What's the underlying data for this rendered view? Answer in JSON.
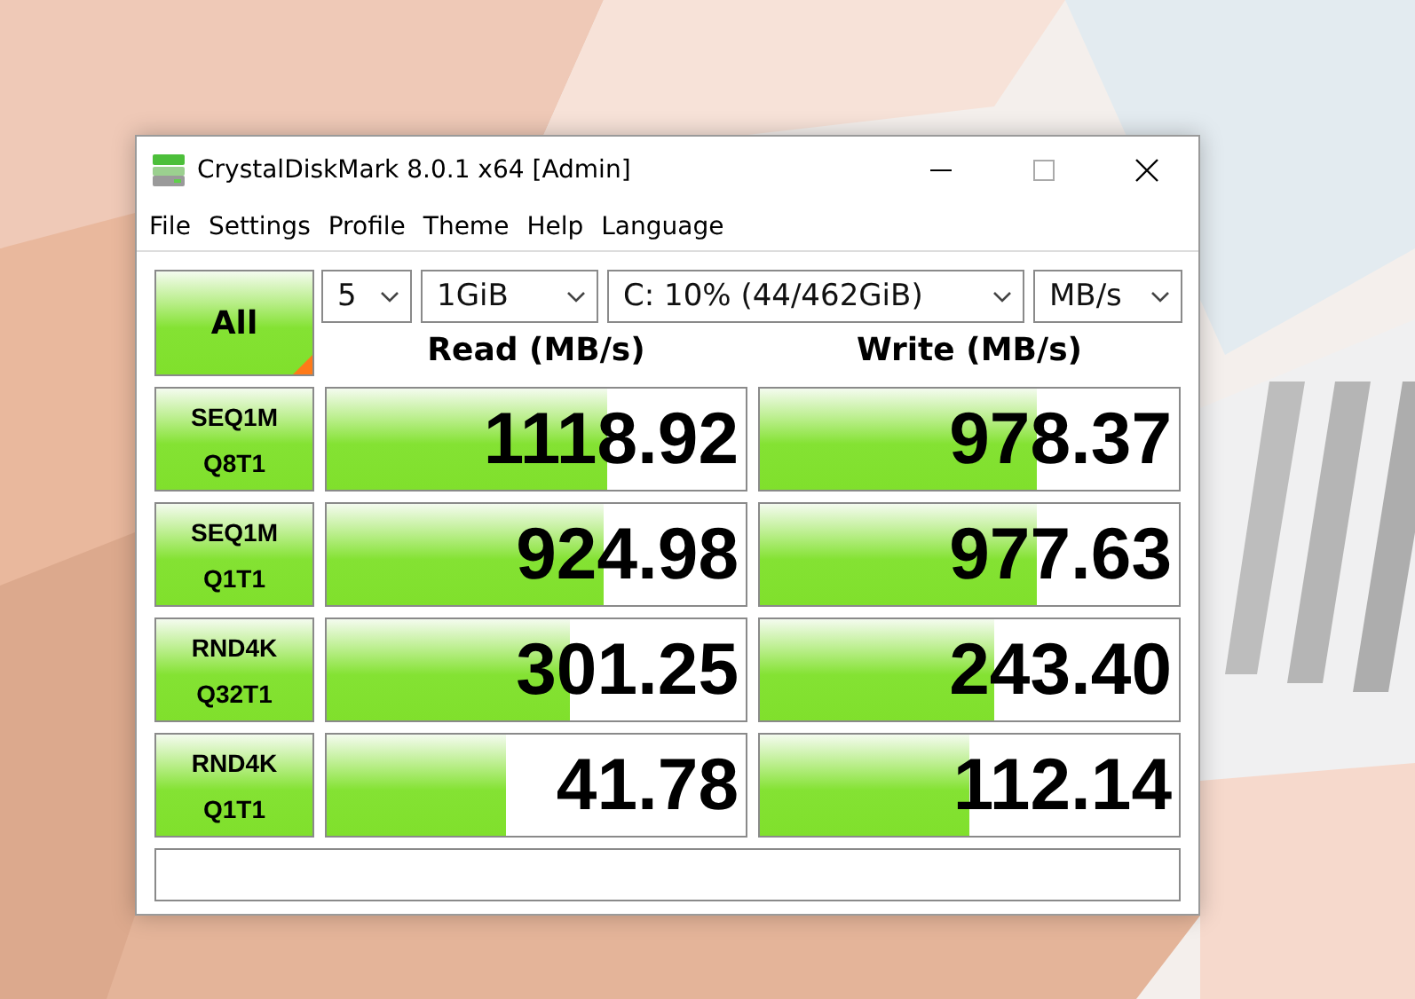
{
  "window": {
    "title": "CrystalDiskMark 8.0.1 x64 [Admin]"
  },
  "menu": [
    "File",
    "Settings",
    "Profile",
    "Theme",
    "Help",
    "Language"
  ],
  "all_button": {
    "label": "All"
  },
  "selects": [
    {
      "value": "5"
    },
    {
      "value": "1GiB"
    },
    {
      "value": "C: 10% (44/462GiB)"
    },
    {
      "value": "MB/s"
    }
  ],
  "columns": [
    "Read (MB/s)",
    "Write (MB/s)"
  ],
  "tests": [
    {
      "name": "SEQ1M",
      "params": "Q8T1",
      "read": {
        "value": "1118.92",
        "level": 0.67
      },
      "write": {
        "value": "978.37",
        "level": 0.66
      }
    },
    {
      "name": "SEQ1M",
      "params": "Q1T1",
      "read": {
        "value": "924.98",
        "level": 0.66
      },
      "write": {
        "value": "977.63",
        "level": 0.66
      }
    },
    {
      "name": "RND4K",
      "params": "Q32T1",
      "read": {
        "value": "301.25",
        "level": 0.58
      },
      "write": {
        "value": "243.40",
        "level": 0.56
      }
    },
    {
      "name": "RND4K",
      "params": "Q1T1",
      "read": {
        "value": "41.78",
        "level": 0.43
      },
      "write": {
        "value": "112.14",
        "level": 0.5
      }
    }
  ]
}
